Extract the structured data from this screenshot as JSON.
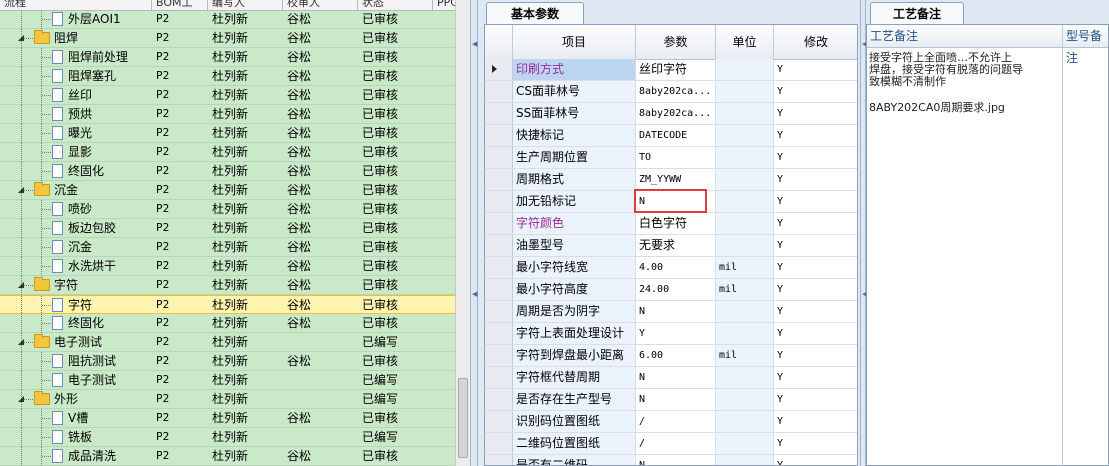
{
  "tree": {
    "headers": {
      "process": "流程",
      "bom": "BOM工",
      "author": "编写人",
      "reviewer": "校审人",
      "status": "状态",
      "ppc": "PPC"
    },
    "rows": [
      {
        "level": 2,
        "type": "doc",
        "name": "外层AOI1",
        "bom": "P2",
        "author": "杜列新",
        "reviewer": "谷松",
        "status": "已审核"
      },
      {
        "level": 1,
        "type": "folder",
        "name": "阻焊",
        "bom": "P2",
        "author": "杜列新",
        "reviewer": "谷松",
        "status": "已审核"
      },
      {
        "level": 2,
        "type": "doc",
        "name": "阻焊前处理",
        "bom": "P2",
        "author": "杜列新",
        "reviewer": "谷松",
        "status": "已审核"
      },
      {
        "level": 2,
        "type": "doc",
        "name": "阻焊塞孔",
        "bom": "P2",
        "author": "杜列新",
        "reviewer": "谷松",
        "status": "已审核"
      },
      {
        "level": 2,
        "type": "doc",
        "name": "丝印",
        "bom": "P2",
        "author": "杜列新",
        "reviewer": "谷松",
        "status": "已审核"
      },
      {
        "level": 2,
        "type": "doc",
        "name": "预烘",
        "bom": "P2",
        "author": "杜列新",
        "reviewer": "谷松",
        "status": "已审核"
      },
      {
        "level": 2,
        "type": "doc",
        "name": "曝光",
        "bom": "P2",
        "author": "杜列新",
        "reviewer": "谷松",
        "status": "已审核"
      },
      {
        "level": 2,
        "type": "doc",
        "name": "显影",
        "bom": "P2",
        "author": "杜列新",
        "reviewer": "谷松",
        "status": "已审核"
      },
      {
        "level": 2,
        "type": "doc",
        "name": "终固化",
        "bom": "P2",
        "author": "杜列新",
        "reviewer": "谷松",
        "status": "已审核"
      },
      {
        "level": 1,
        "type": "folder",
        "name": "沉金",
        "bom": "P2",
        "author": "杜列新",
        "reviewer": "谷松",
        "status": "已审核"
      },
      {
        "level": 2,
        "type": "doc",
        "name": "喷砂",
        "bom": "P2",
        "author": "杜列新",
        "reviewer": "谷松",
        "status": "已审核"
      },
      {
        "level": 2,
        "type": "doc",
        "name": "板边包胶",
        "bom": "P2",
        "author": "杜列新",
        "reviewer": "谷松",
        "status": "已审核"
      },
      {
        "level": 2,
        "type": "doc",
        "name": "沉金",
        "bom": "P2",
        "author": "杜列新",
        "reviewer": "谷松",
        "status": "已审核"
      },
      {
        "level": 2,
        "type": "doc",
        "name": "水洗烘干",
        "bom": "P2",
        "author": "杜列新",
        "reviewer": "谷松",
        "status": "已审核"
      },
      {
        "level": 1,
        "type": "folder",
        "name": "字符",
        "bom": "P2",
        "author": "杜列新",
        "reviewer": "谷松",
        "status": "已审核"
      },
      {
        "level": 2,
        "type": "doc",
        "name": "字符",
        "bom": "P2",
        "author": "杜列新",
        "reviewer": "谷松",
        "status": "已审核",
        "selected": true
      },
      {
        "level": 2,
        "type": "doc",
        "name": "终固化",
        "bom": "P2",
        "author": "杜列新",
        "reviewer": "谷松",
        "status": "已审核"
      },
      {
        "level": 1,
        "type": "folder",
        "name": "电子测试",
        "bom": "P2",
        "author": "杜列新",
        "reviewer": "",
        "status": "已编写"
      },
      {
        "level": 2,
        "type": "doc",
        "name": "阻抗测试",
        "bom": "P2",
        "author": "杜列新",
        "reviewer": "谷松",
        "status": "已审核"
      },
      {
        "level": 2,
        "type": "doc",
        "name": "电子测试",
        "bom": "P2",
        "author": "杜列新",
        "reviewer": "",
        "status": "已编写"
      },
      {
        "level": 1,
        "type": "folder",
        "name": "外形",
        "bom": "P2",
        "author": "杜列新",
        "reviewer": "",
        "status": "已编写"
      },
      {
        "level": 2,
        "type": "doc",
        "name": "V槽",
        "bom": "P2",
        "author": "杜列新",
        "reviewer": "谷松",
        "status": "已审核"
      },
      {
        "level": 2,
        "type": "doc",
        "name": "铣板",
        "bom": "P2",
        "author": "杜列新",
        "reviewer": "",
        "status": "已编写"
      },
      {
        "level": 2,
        "type": "doc",
        "name": "成品清洗",
        "bom": "P2",
        "author": "杜列新",
        "reviewer": "谷松",
        "status": "已审核"
      }
    ]
  },
  "params": {
    "tab_label": "基本参数",
    "headers": {
      "item": "项目",
      "param": "参数",
      "unit": "单位",
      "modify": "修改"
    },
    "rows": [
      {
        "item": "印刷方式",
        "param": "丝印字符",
        "unit": "",
        "modify": "Y",
        "purple": true,
        "active": true,
        "cn": true
      },
      {
        "item": "CS面菲林号",
        "param": "8aby202ca...",
        "unit": "",
        "modify": "Y"
      },
      {
        "item": "SS面菲林号",
        "param": "8aby202ca...",
        "unit": "",
        "modify": "Y"
      },
      {
        "item": "快捷标记",
        "param": "DATECODE",
        "unit": "",
        "modify": "Y"
      },
      {
        "item": "生产周期位置",
        "param": "TO",
        "unit": "",
        "modify": "Y"
      },
      {
        "item": "周期格式",
        "param": "ZM_YYWW",
        "unit": "",
        "modify": "Y"
      },
      {
        "item": "加无铅标记",
        "param": "N",
        "unit": "",
        "modify": "Y"
      },
      {
        "item": "字符颜色",
        "param": "白色字符",
        "unit": "",
        "modify": "Y",
        "purple": true,
        "cn": true
      },
      {
        "item": "油墨型号",
        "param": "无要求",
        "unit": "",
        "modify": "Y",
        "cn": true
      },
      {
        "item": "最小字符线宽",
        "param": "4.00",
        "unit": "mil",
        "modify": "Y"
      },
      {
        "item": "最小字符高度",
        "param": "24.00",
        "unit": "mil",
        "modify": "Y"
      },
      {
        "item": "周期是否为阴字",
        "param": "N",
        "unit": "",
        "modify": "Y"
      },
      {
        "item": "字符上表面处理设计",
        "param": "Y",
        "unit": "",
        "modify": "Y"
      },
      {
        "item": "字符到焊盘最小距离",
        "param": "6.00",
        "unit": "mil",
        "modify": "Y"
      },
      {
        "item": "字符框代替周期",
        "param": "N",
        "unit": "",
        "modify": "Y"
      },
      {
        "item": "是否存在生产型号",
        "param": "N",
        "unit": "",
        "modify": "Y"
      },
      {
        "item": "识别码位置图纸",
        "param": "/",
        "unit": "",
        "modify": "Y"
      },
      {
        "item": "二维码位置图纸",
        "param": "/",
        "unit": "",
        "modify": "Y"
      },
      {
        "item": "是否有二维码",
        "param": "N",
        "unit": "",
        "modify": "Y"
      }
    ]
  },
  "notes": {
    "tab_label": "工艺备注",
    "headers": {
      "process_note": "工艺备注",
      "model_note": "型号备注"
    },
    "text_lines": [
      "接受字符上全面喷…不允许上",
      "焊盘，接受字符有脱落的问题导",
      "致模糊不清制作"
    ],
    "file_name": "8ABY202CA0周期要求.jpg"
  },
  "colors": {
    "tree_bg": "#c9e9c9",
    "selected_row": "#fff3b0",
    "purple_text": "#9b2a9b",
    "highlight": "#e23b3b"
  }
}
